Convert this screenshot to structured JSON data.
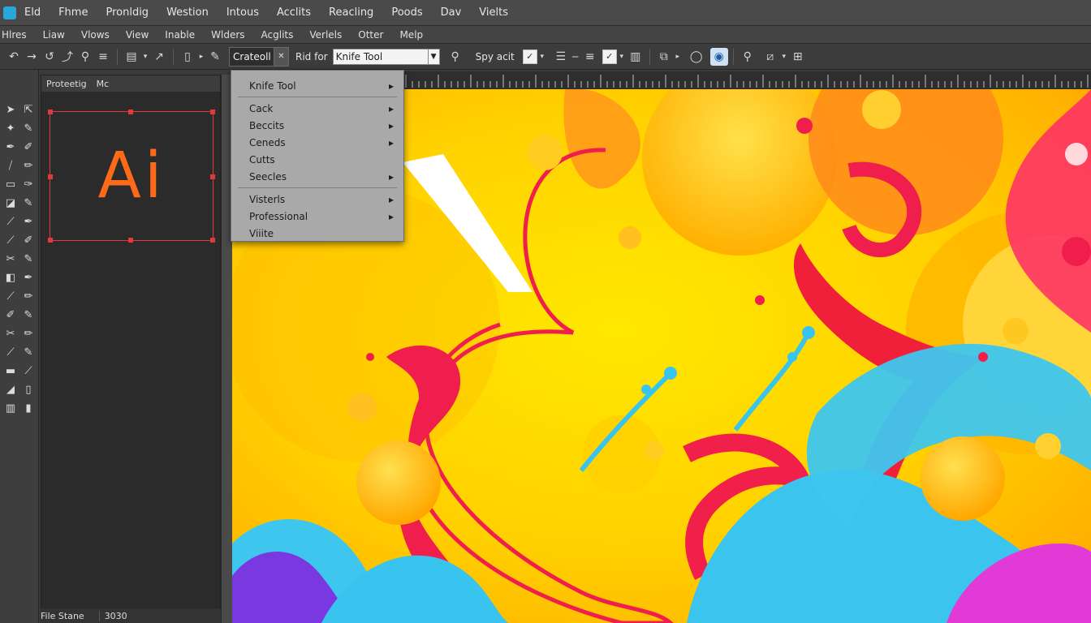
{
  "menubar_primary": [
    "Eld",
    "Fhme",
    "Pronldig",
    "Westion",
    "Intous",
    "Acclits",
    "Reacling",
    "Poods",
    "Dav",
    "Vielts"
  ],
  "menubar_secondary": [
    "Hlres",
    "Liaw",
    "Vlows",
    "View",
    "Inable",
    "Wlders",
    "Acglits",
    "Verlels",
    "Otter",
    "Melp"
  ],
  "controlbar": {
    "current_value": "Crateoll",
    "rid_label": "Rid for",
    "tool_field": "Knife Tool",
    "spy_label": "Spy acit",
    "check1": "✓",
    "check2": "✓"
  },
  "panel": {
    "tab1": "Proteetig",
    "tab2": "Mc",
    "logo_text": "Ai"
  },
  "statusbar": {
    "label": "File Stane",
    "value": "3030"
  },
  "flyout": {
    "items": [
      {
        "label": "Knife Tool",
        "arrow": "▸"
      },
      {
        "label": "Cack",
        "arrow": "▸"
      },
      {
        "label": "Beccits",
        "arrow": "▸"
      },
      {
        "label": "Ceneds",
        "arrow": "▸"
      },
      {
        "label": "Cutts",
        "arrow": ""
      },
      {
        "label": "Seecles",
        "arrow": "▸"
      },
      {
        "label": "Visterls",
        "arrow": "▸"
      },
      {
        "label": "Professional",
        "arrow": "▸"
      },
      {
        "label": "Viiite",
        "arrow": ""
      }
    ]
  },
  "colors": {
    "accent": "#2aa7d8",
    "logo": "#ff6a1a",
    "selection": "#e03a3a",
    "art_yellow": "#ffd400",
    "art_orange": "#ff9a1a",
    "art_red": "#f0204a",
    "art_cyan": "#38c4ee",
    "art_magenta": "#e23ad6"
  }
}
